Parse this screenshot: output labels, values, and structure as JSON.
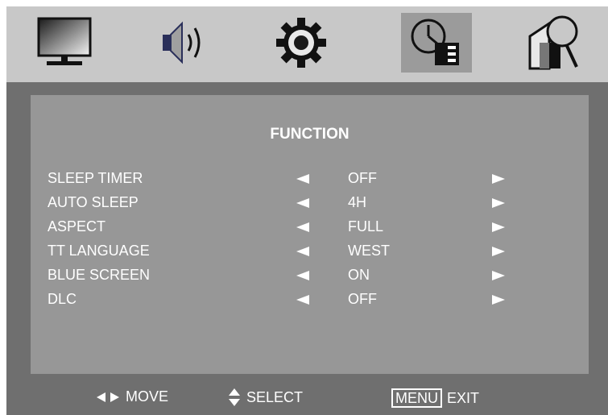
{
  "tabs": [
    {
      "icon": "tv-picture-icon",
      "active": false
    },
    {
      "icon": "speaker-sound-icon",
      "active": false
    },
    {
      "icon": "gear-setup-icon",
      "active": false
    },
    {
      "icon": "clock-function-icon",
      "active": true
    },
    {
      "icon": "magnifier-search-icon",
      "active": false
    }
  ],
  "menu": {
    "title": "FUNCTION",
    "rows": [
      {
        "label": "SLEEP TIMER",
        "value": "OFF"
      },
      {
        "label": "AUTO SLEEP",
        "value": "4H"
      },
      {
        "label": "ASPECT",
        "value": "FULL"
      },
      {
        "label": "TT LANGUAGE",
        "value": "WEST"
      },
      {
        "label": "BLUE SCREEN",
        "value": "ON"
      },
      {
        "label": "DLC",
        "value": "OFF"
      }
    ]
  },
  "footer": {
    "move_label": "MOVE",
    "select_label": "SELECT",
    "menu_key": "MENU",
    "exit_label": "EXIT"
  }
}
